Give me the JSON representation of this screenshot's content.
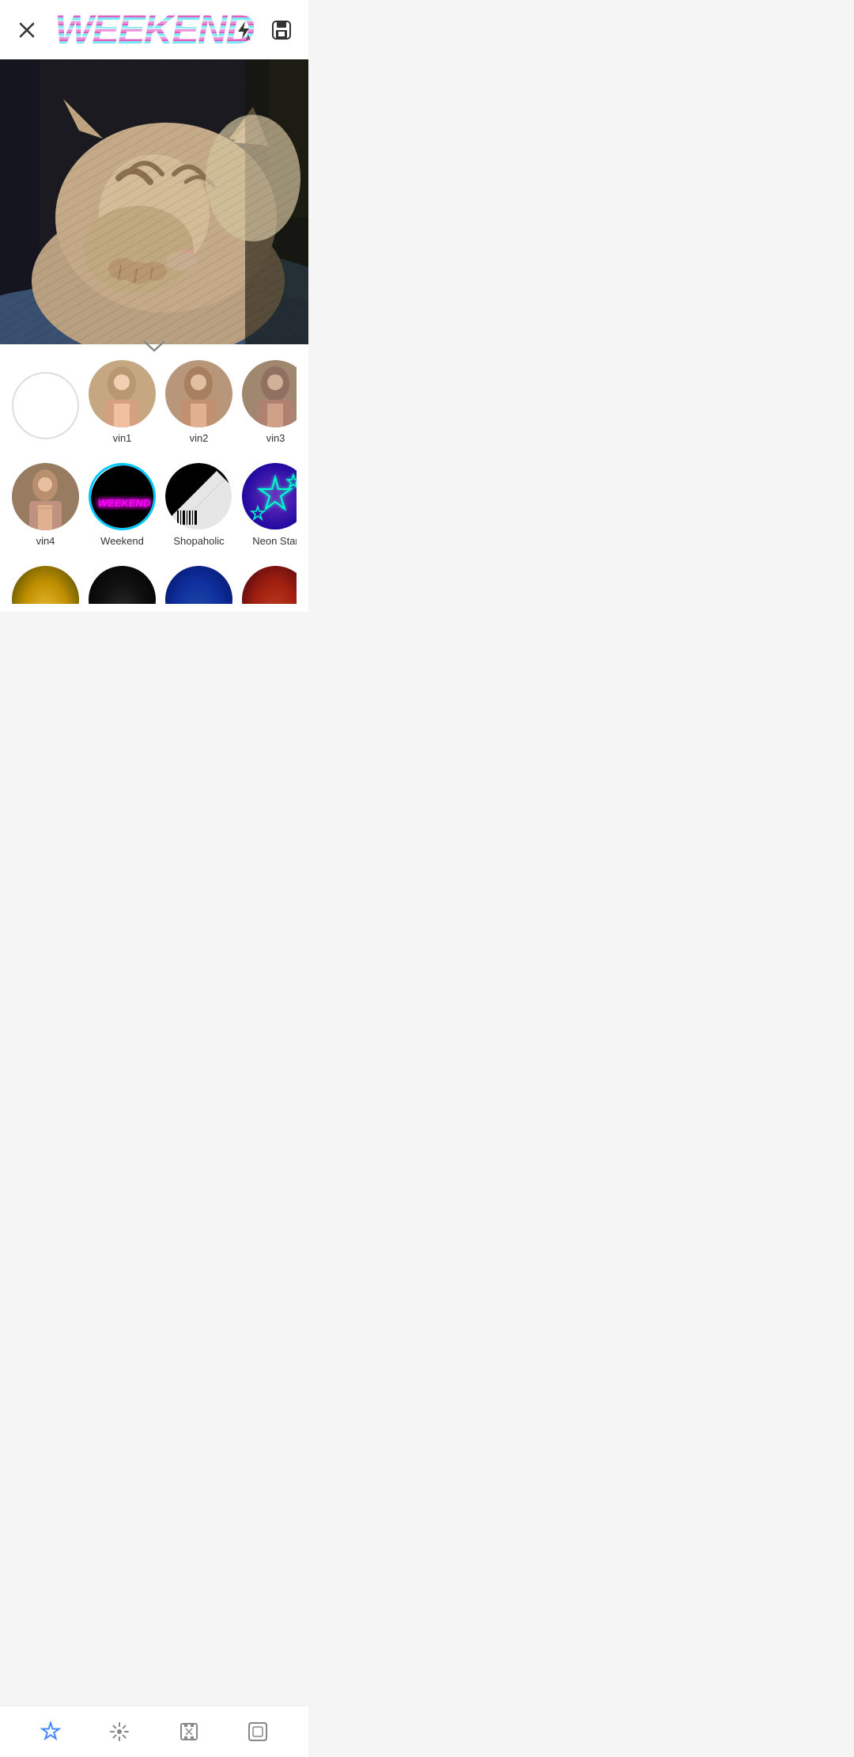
{
  "app": {
    "title": "WEEKEND"
  },
  "header": {
    "close_label": "×",
    "flash_icon": "flash-auto-icon",
    "save_icon": "save-icon"
  },
  "filters": {
    "row1": [
      {
        "id": "none",
        "label": "",
        "type": "empty"
      },
      {
        "id": "vin1",
        "label": "vin1",
        "type": "portrait"
      },
      {
        "id": "vin2",
        "label": "vin2",
        "type": "portrait"
      },
      {
        "id": "vin3",
        "label": "vin3",
        "type": "portrait"
      }
    ],
    "row2": [
      {
        "id": "vin4",
        "label": "vin4",
        "type": "portrait"
      },
      {
        "id": "weekend",
        "label": "Weekend",
        "type": "weekend",
        "active": true
      },
      {
        "id": "shopaholic",
        "label": "Shopaholic",
        "type": "shopaholic"
      },
      {
        "id": "neonstar",
        "label": "Neon Star",
        "type": "neonstar"
      }
    ]
  },
  "bottom_nav": {
    "items": [
      {
        "id": "stickers",
        "label": "stickers",
        "active": true
      },
      {
        "id": "effects",
        "label": "effects"
      },
      {
        "id": "frames",
        "label": "frames"
      },
      {
        "id": "layout",
        "label": "layout"
      }
    ]
  },
  "chevron": "∨"
}
